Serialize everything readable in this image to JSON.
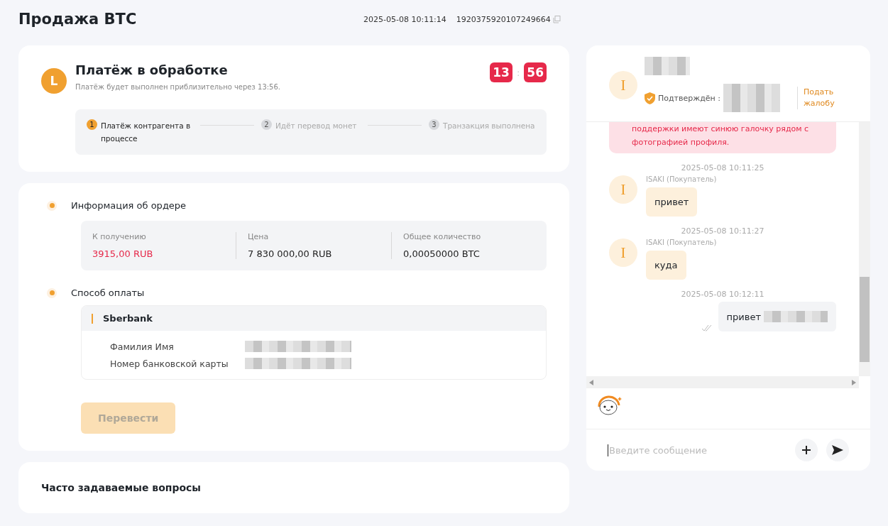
{
  "header": {
    "title": "Продажа BTC",
    "created": "2025-05-08 10:11:14",
    "order_id": "1920375920107249664"
  },
  "status": {
    "avatar": "L",
    "title": "Платёж в обработке",
    "subtitle": "Платёж будет выполнен приблизительно через 13:56.",
    "timer": {
      "minutes": "13",
      "separator": ":",
      "seconds": "56"
    },
    "steps": [
      {
        "number": "1",
        "label": "Платёж контрагента в процессе",
        "active": true
      },
      {
        "number": "2",
        "label": "Идёт перевод монет",
        "active": false
      },
      {
        "number": "3",
        "label": "Транзакция выполнена",
        "active": false
      }
    ]
  },
  "order": {
    "section_title": "Информация об ордере",
    "fields": [
      {
        "label": "К получению",
        "value": "3915,00 RUB",
        "highlight": true
      },
      {
        "label": "Цена",
        "value": "7 830 000,00 RUB",
        "highlight": false
      },
      {
        "label": "Общее количество",
        "value": "0,00050000 BTC",
        "highlight": false
      }
    ]
  },
  "payment": {
    "section_title": "Способ оплаты",
    "bank": "Sberbank",
    "rows": [
      {
        "label": "Фамилия Имя"
      },
      {
        "label": "Номер банковской карты"
      }
    ],
    "button": {
      "label": "Перевести",
      "disabled": true
    }
  },
  "faq": {
    "title": "Часто задаваемые вопросы"
  },
  "chat": {
    "avatar": "I",
    "verified": "Подтверждён :",
    "complaint": "Подать жалобу",
    "messages": [
      {
        "kind": "notice",
        "text": "поддержки имеют синюю галочку рядом с фотографией профиля."
      },
      {
        "kind": "time",
        "text": "2025-05-08 10:11:25"
      },
      {
        "kind": "incoming",
        "avatar": "I",
        "sender": "ISAKI (Покупатель)",
        "text": "привет"
      },
      {
        "kind": "time",
        "text": "2025-05-08 10:11:27"
      },
      {
        "kind": "incoming",
        "avatar": "I",
        "sender": "ISAKI (Покупатель)",
        "text": "куда"
      },
      {
        "kind": "time",
        "text": "2025-05-08 10:12:11"
      },
      {
        "kind": "outgoing",
        "text": "привет",
        "read": true
      }
    ],
    "input": {
      "placeholder": "Введите сообщение"
    }
  }
}
